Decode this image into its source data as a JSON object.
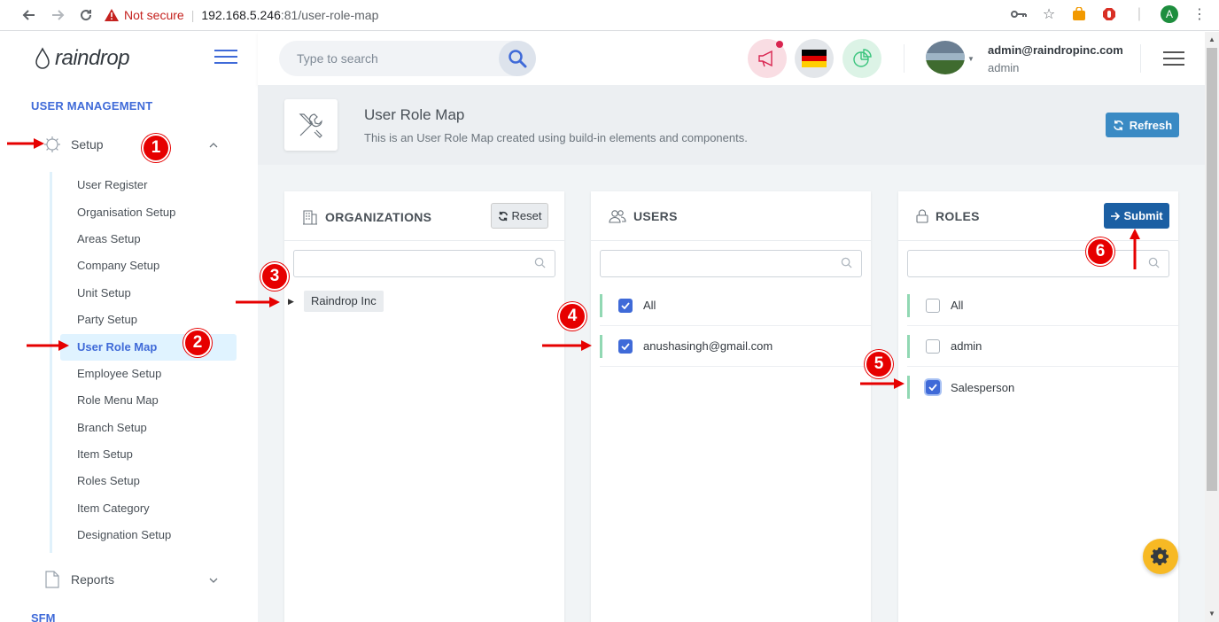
{
  "browser": {
    "security_label": "Not secure",
    "url_host": "192.168.5.246",
    "url_path": ":81/user-role-map",
    "profile_initial": "A"
  },
  "sidebar": {
    "logo_text": "raindrop",
    "section_heading": "USER MANAGEMENT",
    "setup_label": "Setup",
    "sub_items": [
      "User Register",
      "Organisation Setup",
      "Areas Setup",
      "Company Setup",
      "Unit Setup",
      "Party Setup",
      "User Role Map",
      "Employee Setup",
      "Role Menu Map",
      "Branch Setup",
      "Item Setup",
      "Roles Setup",
      "Item Category",
      "Designation Setup"
    ],
    "active_item": "User Role Map",
    "reports_label": "Reports",
    "next_section": "SFM"
  },
  "header": {
    "search_placeholder": "Type to search",
    "user_email": "admin@raindropinc.com",
    "user_role": "admin"
  },
  "page": {
    "title": "User Role Map",
    "subtitle": "This is an User Role Map created using build-in elements and components.",
    "refresh_label": "Refresh"
  },
  "organizations": {
    "title": "ORGANIZATIONS",
    "reset_label": "Reset",
    "tree_root": "Raindrop Inc"
  },
  "users": {
    "title": "USERS",
    "rows": [
      {
        "label": "All",
        "checked": true
      },
      {
        "label": "anushasingh@gmail.com",
        "checked": true
      }
    ]
  },
  "roles": {
    "title": "ROLES",
    "submit_label": "Submit",
    "rows": [
      {
        "label": "All",
        "checked": false
      },
      {
        "label": "admin",
        "checked": false
      },
      {
        "label": "Salesperson",
        "checked": true
      }
    ]
  },
  "annotations": [
    "1",
    "2",
    "3",
    "4",
    "5",
    "6"
  ],
  "colors": {
    "accent": "#3f6ad8",
    "annotation": "#e60000",
    "submit": "#1b5fa3",
    "refresh": "#3a8ac4",
    "row_bar": "#91d8b3",
    "fab": "#f7b924"
  }
}
